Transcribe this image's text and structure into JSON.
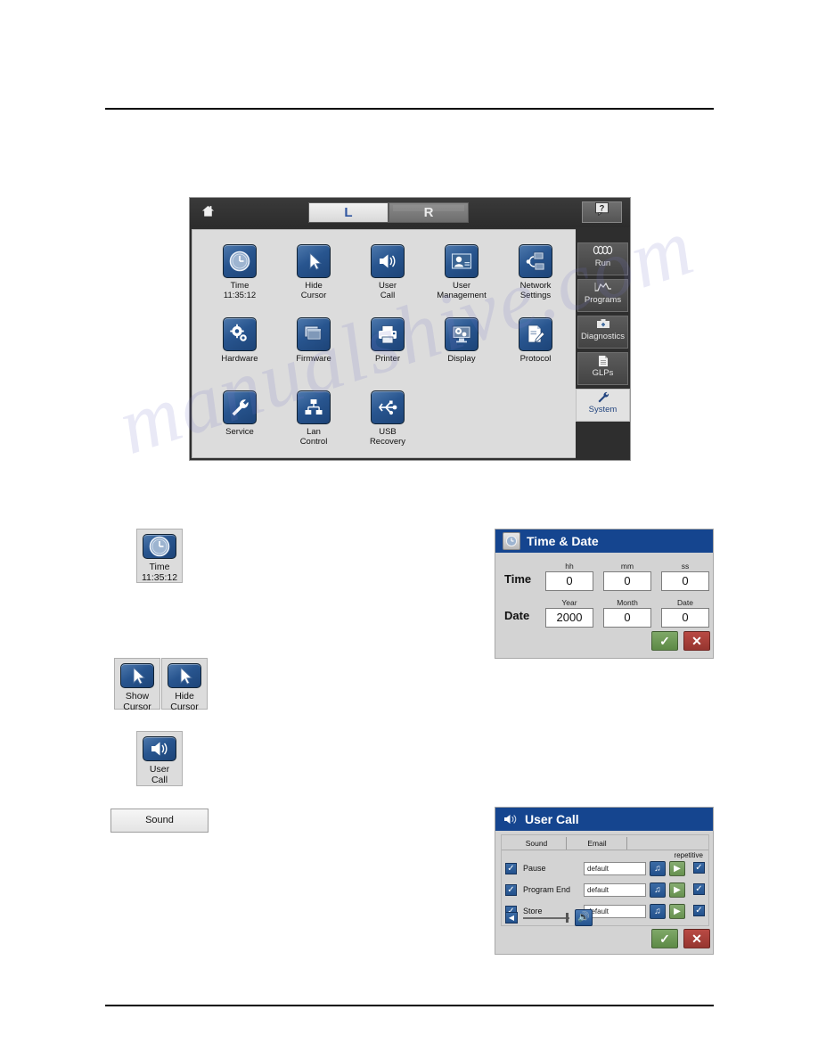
{
  "watermark": "manualshive.com",
  "device": {
    "topbar": {
      "home_icon": "home-icon",
      "segment_left": "L",
      "segment_right": "R",
      "help_label": "?"
    },
    "tiles": [
      {
        "icon": "clock-icon",
        "line1": "Time",
        "line2": "11:35:12"
      },
      {
        "icon": "cursor-arrow-icon",
        "line1": "Hide",
        "line2": "Cursor"
      },
      {
        "icon": "speaker-icon",
        "line1": "User",
        "line2": "Call"
      },
      {
        "icon": "user-card-icon",
        "line1": "User",
        "line2": "Management"
      },
      {
        "icon": "network-icon",
        "line1": "Network",
        "line2": "Settings"
      },
      {
        "icon": "gears-icon",
        "line1": "Hardware",
        "line2": ""
      },
      {
        "icon": "windows-stack-icon",
        "line1": "Firmware",
        "line2": ""
      },
      {
        "icon": "printer-icon",
        "line1": "Printer",
        "line2": ""
      },
      {
        "icon": "monitor-gear-icon",
        "line1": "Display",
        "line2": ""
      },
      {
        "icon": "document-pencil-icon",
        "line1": "Protocol",
        "line2": ""
      },
      {
        "icon": "wrench-icon",
        "line1": "Service",
        "line2": ""
      },
      {
        "icon": "lan-node-icon",
        "line1": "Lan",
        "line2": "Control"
      },
      {
        "icon": "usb-icon",
        "line1": "USB",
        "line2": "Recovery"
      }
    ],
    "tabs": [
      {
        "icon": "coil-icon",
        "label": "Run",
        "active": false
      },
      {
        "icon": "curve-icon",
        "label": "Programs",
        "active": false
      },
      {
        "icon": "toolbox-icon",
        "label": "Diagnostics",
        "active": false
      },
      {
        "icon": "document-icon",
        "label": "GLPs",
        "active": false
      },
      {
        "icon": "wrench-icon",
        "label": "System",
        "active": true
      }
    ]
  },
  "callouts": {
    "time": {
      "icon": "clock-icon",
      "line1": "Time",
      "line2": "11:35:12"
    },
    "show_cursor": {
      "icon": "cursor-arrow-icon",
      "line1": "Show",
      "line2": "Cursor"
    },
    "hide_cursor": {
      "icon": "cursor-arrow-icon",
      "line1": "Hide",
      "line2": "Cursor"
    },
    "user_call": {
      "icon": "speaker-icon",
      "line1": "User",
      "line2": "Call"
    },
    "sound_button": "Sound"
  },
  "time_dialog": {
    "title": "Time & Date",
    "title_icon": "clock-icon",
    "row_time_label": "Time",
    "row_date_label": "Date",
    "fields": {
      "hh": {
        "caption": "hh",
        "value": "0"
      },
      "mm": {
        "caption": "mm",
        "value": "0"
      },
      "ss": {
        "caption": "ss",
        "value": "0"
      },
      "year": {
        "caption": "Year",
        "value": "2000"
      },
      "month": {
        "caption": "Month",
        "value": "0"
      },
      "date": {
        "caption": "Date",
        "value": "0"
      }
    },
    "ok_label": "✓",
    "cancel_label": "✕"
  },
  "usercall_dialog": {
    "title": "User Call",
    "title_icon": "speaker-icon",
    "tabs": [
      {
        "label": "Sound"
      },
      {
        "label": "Email"
      }
    ],
    "repetitive_header": "repetitive",
    "rows": [
      {
        "enabled_mark": "✓",
        "name": "Pause",
        "sound": "default",
        "note_icon": "music-note-icon",
        "play_icon": "play-icon",
        "repetitive_mark": "✓"
      },
      {
        "enabled_mark": "✓",
        "name": "Program End",
        "sound": "default",
        "note_icon": "music-note-icon",
        "play_icon": "play-icon",
        "repetitive_mark": "✓"
      },
      {
        "enabled_mark": "✓",
        "name": "Store",
        "sound": "default",
        "note_icon": "music-note-icon",
        "play_icon": "play-icon",
        "repetitive_mark": "✓"
      }
    ],
    "volume": {
      "min_icon": "speaker-low-icon",
      "max_icon": "speaker-high-icon"
    },
    "ok_label": "✓",
    "cancel_label": "✕"
  },
  "colors": {
    "dialog_title_blue": "#15458f",
    "icon_blue": "#25548f",
    "accent_link_blue": "#2f55a0",
    "ok_green": "#5d8a46",
    "cancel_red": "#963630",
    "device_chrome": "#2e2e2e",
    "panel_gray": "#dcdcdc"
  }
}
